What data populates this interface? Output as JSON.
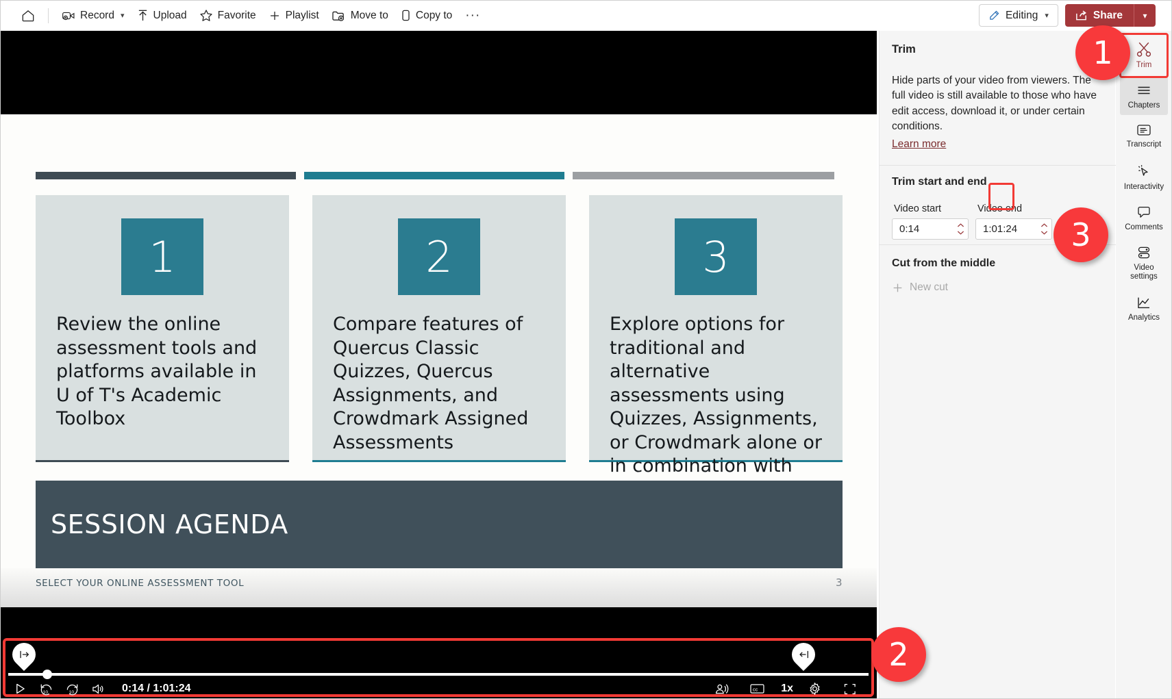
{
  "topbar": {
    "home_icon": "home-icon",
    "buttons": [
      {
        "icon": "record-icon",
        "label": "Record",
        "caret": true
      },
      {
        "icon": "upload-icon",
        "label": "Upload",
        "caret": false
      },
      {
        "icon": "star-icon",
        "label": "Favorite",
        "caret": false
      },
      {
        "icon": "plus-icon",
        "label": "Playlist",
        "caret": false
      },
      {
        "icon": "move-to-icon",
        "label": "Move to",
        "caret": false
      },
      {
        "icon": "copy-to-icon",
        "label": "Copy to",
        "caret": false
      }
    ],
    "overflow_label": "···",
    "editing_label": "Editing",
    "share_label": "Share",
    "share_color": "#a4373a"
  },
  "slide": {
    "cards": [
      {
        "number": "1",
        "text": "Review the online assessment tools and platforms available in   U of  T's Academic Toolbox"
      },
      {
        "number": "2",
        "text": "Compare features of Quercus Classic Quizzes, Quercus Assignments, and Crowdmark Assigned Assessments"
      },
      {
        "number": "3",
        "text": "Explore options for traditional and alternative assessments using Quizzes,  Assignments, or Crowdmark alone or in combination with other tools"
      }
    ],
    "band_title": "SESSION AGENDA",
    "footer_left": "SELECT YOUR ONLINE ASSESSMENT TOOL",
    "footer_page": "3",
    "colors": {
      "dark": "#3e4b54",
      "teal": "#1f7d91",
      "grey": "#9c9fa2",
      "card_bg": "#d9e0e0",
      "band": "#40505a"
    }
  },
  "player": {
    "current_time": "0:14",
    "duration": "1:01:24",
    "time_display": "0:14 / 1:01:24",
    "speed_label": "1x",
    "controls": [
      "play-icon",
      "rewind-10-icon",
      "forward-10-icon",
      "volume-icon"
    ],
    "right_controls": [
      "noise-suppression-icon",
      "closed-captions-icon",
      "playback-speed",
      "settings-gear-icon",
      "fullscreen-icon"
    ],
    "trim_handle_start": "trim-start-handle",
    "trim_handle_end": "trim-end-handle"
  },
  "panel": {
    "title": "Trim",
    "description": "Hide parts of your video from viewers. The full video is still available to those who have edit access, download it, or under certain conditions.",
    "learn_more": "Learn more",
    "section_trim": "Trim start and end",
    "video_start_label": "Video start",
    "video_start_value": "0:14",
    "video_end_label": "Video end",
    "video_end_value": "1:01:24",
    "confirm_icon": "checkmark-icon",
    "cancel_icon": "close-x-icon",
    "section_cut": "Cut from the middle",
    "new_cut_label": "New cut"
  },
  "rail": {
    "items": [
      {
        "icon": "scissors-icon",
        "label": "Trim",
        "state": "selected"
      },
      {
        "icon": "chapters-icon",
        "label": "Chapters",
        "state": "hover"
      },
      {
        "icon": "transcript-icon",
        "label": "Transcript",
        "state": "normal"
      },
      {
        "icon": "cursor-sparkle-icon",
        "label": "Interactivity",
        "state": "normal"
      },
      {
        "icon": "comment-bubble-icon",
        "label": "Comments",
        "state": "normal"
      },
      {
        "icon": "toggles-icon",
        "label": "Video settings",
        "state": "normal"
      },
      {
        "icon": "analytics-chart-icon",
        "label": "Analytics",
        "state": "normal"
      }
    ]
  },
  "badges": [
    {
      "number": "1",
      "target": "trim-rail-button"
    },
    {
      "number": "2",
      "target": "video-timeline"
    },
    {
      "number": "3",
      "target": "confirm-trim-button"
    }
  ],
  "annotation_color": "#f8393b"
}
